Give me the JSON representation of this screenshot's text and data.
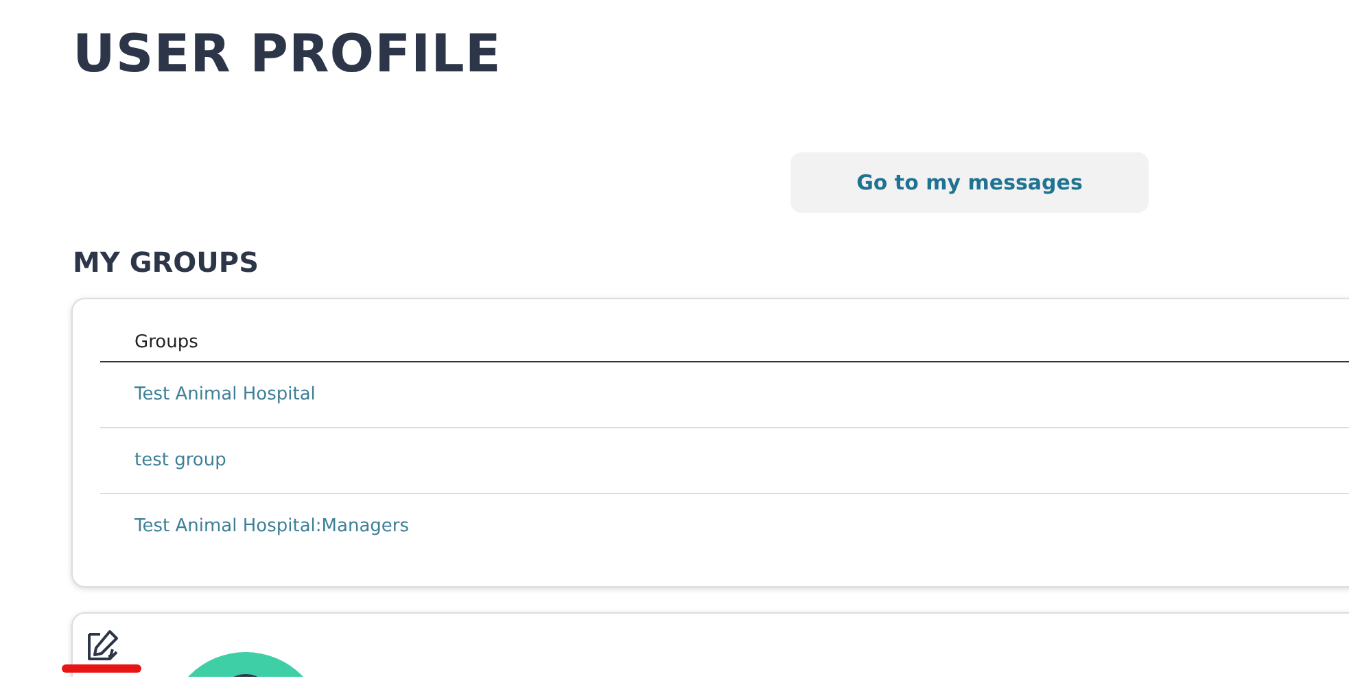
{
  "page_title": "USER PROFILE",
  "messages_button": "Go to my messages",
  "groups_section": {
    "title": "MY GROUPS",
    "column": "Groups",
    "rows": [
      "Test Animal Hospital",
      "test group",
      "Test Animal Hospital:Managers"
    ]
  },
  "profile_card": {
    "edit_marked": true
  }
}
